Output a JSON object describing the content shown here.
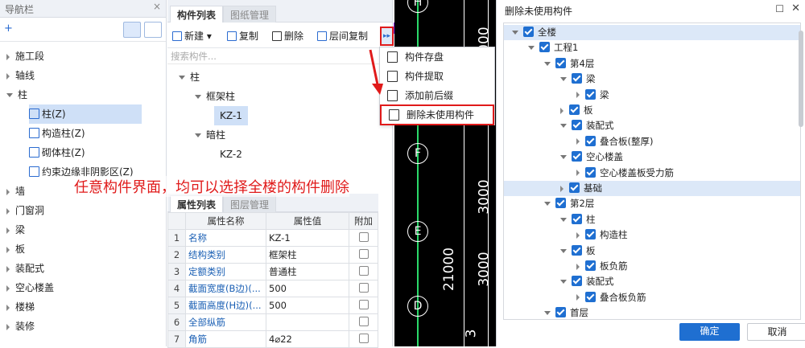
{
  "nav": {
    "title": "导航栏",
    "items": [
      "施工段",
      "轴线",
      "柱",
      "墙",
      "门窗洞",
      "梁",
      "板",
      "装配式",
      "空心楼盖",
      "楼梯",
      "装修"
    ],
    "column_children": [
      "柱(Z)",
      "构造柱(Z)",
      "砌体柱(Z)",
      "约束边缘非阴影区(Z)"
    ]
  },
  "component": {
    "tab_list": "构件列表",
    "tab_drawings": "图纸管理",
    "new_label": "新建",
    "copy_label": "复制",
    "delete_label": "删除",
    "floor_copy_label": "层间复制",
    "search_placeholder": "搜索构件...",
    "tree_root": "柱",
    "group1": "框架柱",
    "item1": "KZ-1",
    "group2": "暗柱",
    "item2": "KZ-2"
  },
  "props": {
    "tab_props": "属性列表",
    "tab_layers": "图层管理",
    "col_name": "属性名称",
    "col_value": "属性值",
    "col_extra": "附加",
    "rows": [
      {
        "n": "1",
        "name": "名称",
        "value": "KZ-1"
      },
      {
        "n": "2",
        "name": "结构类别",
        "value": "框架柱"
      },
      {
        "n": "3",
        "name": "定额类别",
        "value": "普通柱"
      },
      {
        "n": "4",
        "name": "截面宽度(B边)(...",
        "value": "500"
      },
      {
        "n": "5",
        "name": "截面高度(H边)(...",
        "value": "500"
      },
      {
        "n": "6",
        "name": "全部纵筋",
        "value": ""
      },
      {
        "n": "7",
        "name": "角筋",
        "value": "4⌀22"
      }
    ]
  },
  "menu": {
    "items": [
      "构件存盘",
      "构件提取",
      "添加前后缀",
      "删除未使用构件"
    ]
  },
  "annotation": "任意构件界面，均可以选择全楼的构件删除",
  "cad": {
    "axis_labels": [
      "H",
      "F",
      "E",
      "D"
    ],
    "dims_right": [
      "3000",
      "3000",
      "3000",
      "3"
    ],
    "dim_total": "21000"
  },
  "dialog": {
    "title": "删除未使用构件",
    "ok": "确定",
    "cancel": "取消",
    "tree": [
      {
        "label": "全楼",
        "level": 0,
        "arrow": "down",
        "hl": true
      },
      {
        "label": "工程1",
        "level": 1,
        "arrow": "down"
      },
      {
        "label": "第4层",
        "level": 2,
        "arrow": "down"
      },
      {
        "label": "梁",
        "level": 3,
        "arrow": "down"
      },
      {
        "label": "梁",
        "level": 4,
        "arrow": "right"
      },
      {
        "label": "板",
        "level": 3,
        "arrow": "right"
      },
      {
        "label": "装配式",
        "level": 3,
        "arrow": "down"
      },
      {
        "label": "叠合板(整厚)",
        "level": 4,
        "arrow": "right"
      },
      {
        "label": "空心楼盖",
        "level": 3,
        "arrow": "down"
      },
      {
        "label": "空心楼盖板受力筋",
        "level": 4,
        "arrow": "right"
      },
      {
        "label": "基础",
        "level": 3,
        "arrow": "right",
        "hl": true
      },
      {
        "label": "第2层",
        "level": 2,
        "arrow": "down"
      },
      {
        "label": "柱",
        "level": 3,
        "arrow": "down"
      },
      {
        "label": "构造柱",
        "level": 4,
        "arrow": "right"
      },
      {
        "label": "板",
        "level": 3,
        "arrow": "down"
      },
      {
        "label": "板负筋",
        "level": 4,
        "arrow": "right"
      },
      {
        "label": "装配式",
        "level": 3,
        "arrow": "down"
      },
      {
        "label": "叠合板负筋",
        "level": 4,
        "arrow": "right"
      },
      {
        "label": "首层",
        "level": 2,
        "arrow": "down"
      }
    ]
  },
  "colors": {
    "accent": "#1f6fd1",
    "highlight_red": "#e01a1a",
    "cad_green": "#2bd96a"
  }
}
